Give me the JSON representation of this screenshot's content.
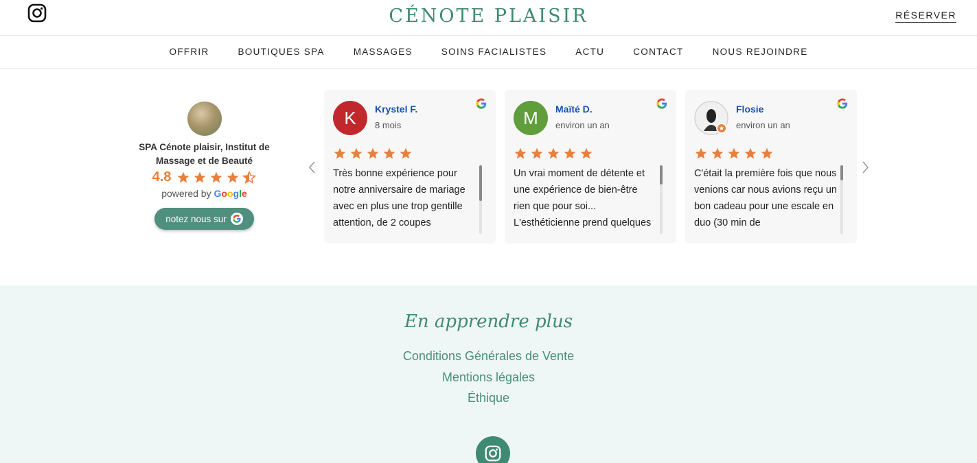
{
  "header": {
    "brand": "CÉNOTE PLAISIR",
    "reserve_label": "RÉSERVER"
  },
  "nav": {
    "items": [
      "OFFRIR",
      "BOUTIQUES SPA",
      "MASSAGES",
      "SOINS FACIALISTES",
      "ACTU",
      "CONTACT",
      "NOUS REJOINDRE"
    ]
  },
  "reviews_widget": {
    "business_name": "SPA Cénote plaisir, Institut de Massage et de Beauté",
    "rating": "4.8",
    "rating_value": 4.8,
    "powered_by": "powered by",
    "google_word": "Google",
    "rate_button_label": "notez nous sur",
    "reviews": [
      {
        "initial": "K",
        "name": "Krystel F.",
        "when": "8 mois",
        "avatar_color": "#c0282d",
        "stars": 5,
        "text": "Très bonne expérience pour notre anniversaire de mariage avec en plus une trop gentille attention, de 2 coupes"
      },
      {
        "initial": "M",
        "name": "Maïté D.",
        "when": "environ un an",
        "avatar_color": "#5f9e3a",
        "stars": 5,
        "text": "Un vrai moment de détente et une expérience de bien-être rien que pour soi... L'esthéticienne prend quelques"
      },
      {
        "initial": "",
        "name": "Flosie",
        "when": "environ un an",
        "avatar_color": "#e9e9e9",
        "stars": 5,
        "text": "C'était la première fois que nous venions car nous avions reçu un bon cadeau pour une escale en duo (30 min de"
      }
    ]
  },
  "footer": {
    "title": "En apprendre plus",
    "links": [
      "Conditions Générales de Vente",
      "Mentions légales",
      "Éthique"
    ]
  },
  "colors": {
    "brand_green": "#3f8a72",
    "star_orange": "#e8803d",
    "footer_bg": "#eef6f6"
  }
}
